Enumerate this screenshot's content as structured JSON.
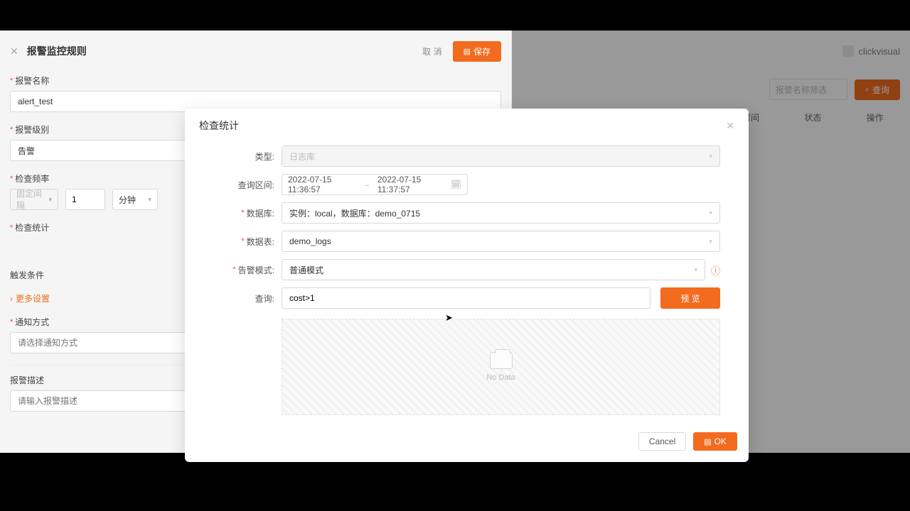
{
  "leftPanel": {
    "title": "报警监控规则",
    "cancel": "取 消",
    "save": "保存",
    "alarmNameLabel": "报警名称",
    "alarmNameValue": "alert_test",
    "alarmLevelLabel": "报警级别",
    "alarmLevelValue": "告警",
    "checkFreqLabel": "检查频率",
    "freqTypePlaceholder": "固定间隔",
    "freqNum": "1",
    "freqUnit": "分钟",
    "checkStatLabel": "检查统计",
    "triggerLabel": "触发条件",
    "moreSettings": "更多设置",
    "notifyLabel": "通知方式",
    "notifyPlaceholder": "请选择通知方式",
    "descLabel": "报警描述",
    "descPlaceholder": "请输入报警描述"
  },
  "rightPanel": {
    "brand": "clickvisual",
    "filterPlaceholder": "报警名称筛选",
    "searchBtn": "查询",
    "colTime": "时间",
    "colStatus": "状态",
    "colOps": "操作"
  },
  "modal": {
    "title": "检查统计",
    "typeLabel": "类型:",
    "typeValue": "日志库",
    "rangeLabel": "查询区间:",
    "rangeStart": "2022-07-15 11:36:57",
    "rangeEnd": "2022-07-15 11:37:57",
    "dbLabel": "数据库:",
    "dbValue": "实例：local，数据库：demo_0715",
    "tableLabel": "数据表:",
    "tableValue": "demo_logs",
    "alarmModeLabel": "告警模式:",
    "alarmModeValue": "普通模式",
    "queryLabel": "查询:",
    "queryValue": "cost>1",
    "previewBtn": "预 览",
    "noData": "No Data",
    "cancel": "Cancel",
    "ok": "OK"
  }
}
